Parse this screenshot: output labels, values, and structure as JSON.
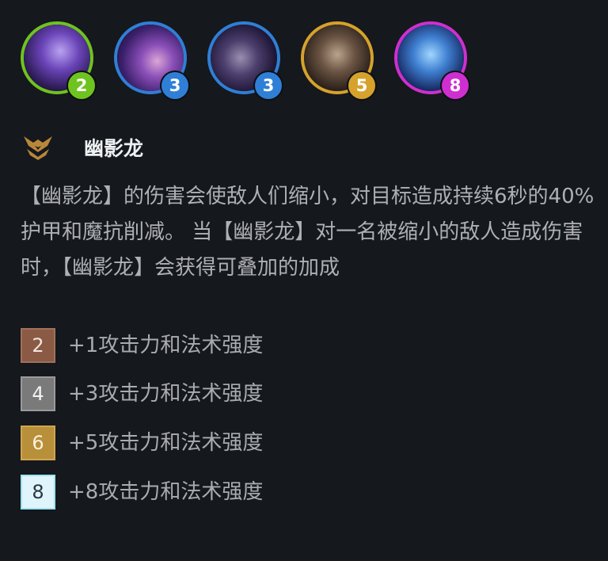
{
  "colors": {
    "background": "#15181d",
    "cost_2": "#6fc31f",
    "cost_3": "#2f7fd6",
    "cost_5": "#d6a22c",
    "cost_8": "#cf2fd0",
    "tier_bronze": "#8a5a45",
    "tier_silver": "#7a7a7a",
    "tier_gold": "#b8903a",
    "tier_prismatic": "#dff5fb"
  },
  "champions": [
    {
      "cost": "2",
      "icon": "champion-portrait-purple-armored"
    },
    {
      "cost": "3",
      "icon": "champion-portrait-purple-female"
    },
    {
      "cost": "3",
      "icon": "champion-portrait-dark-male"
    },
    {
      "cost": "5",
      "icon": "champion-portrait-brown-dragon"
    },
    {
      "cost": "8",
      "icon": "champion-portrait-blue-dragon"
    }
  ],
  "trait": {
    "icon": "whispers-dragon-trait-icon",
    "name": "幽影龙",
    "description": "【幽影龙】的伤害会使敌人们缩小，对目标造成持续6秒的40%护甲和魔抗削减。 当【幽影龙】对一名被缩小的敌人造成伤害时，【幽影龙】会获得可叠加的加成"
  },
  "tiers": [
    {
      "count": "2",
      "text": "+1攻击力和法术强度",
      "style": "bronze"
    },
    {
      "count": "4",
      "text": "+3攻击力和法术强度",
      "style": "silver"
    },
    {
      "count": "6",
      "text": "+5攻击力和法术强度",
      "style": "gold"
    },
    {
      "count": "8",
      "text": "+8攻击力和法术强度",
      "style": "prismatic"
    }
  ]
}
